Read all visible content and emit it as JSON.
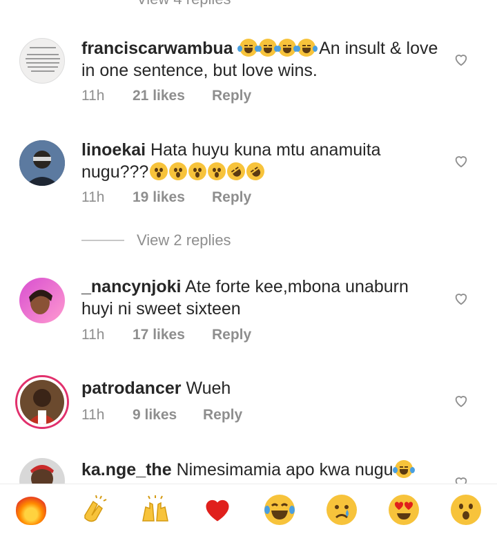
{
  "top_view_replies": "View 4 replies",
  "comments": [
    {
      "username": "franciscarwambua",
      "text": "An insult & love in one sentence, but love wins.",
      "time": "11h",
      "likes": "21 likes",
      "reply": "Reply"
    },
    {
      "username": "linoekai",
      "text": "Hata huyu kuna mtu anamuita nugu???",
      "time": "11h",
      "likes": "19 likes",
      "reply": "Reply"
    },
    {
      "username": "_nancynjoki",
      "text": "Ate forte kee,mbona unaburn huyi ni sweet sixteen",
      "time": "11h",
      "likes": "17 likes",
      "reply": "Reply"
    },
    {
      "username": "patrodancer",
      "text": "Wueh",
      "time": "11h",
      "likes": "9 likes",
      "reply": "Reply"
    },
    {
      "username": "ka.nge_the",
      "text": "Nimesimamia apo kwa nugu"
    }
  ],
  "mid_view_replies": "View 2 replies",
  "reactions": [
    "fire-emoji",
    "clapping-hands-emoji",
    "raising-hands-emoji",
    "red-heart-emoji",
    "tears-of-joy-emoji",
    "crying-face-emoji",
    "heart-eyes-emoji",
    "astonished-face-emoji"
  ],
  "colors": {
    "heart": "#e0201c",
    "meta": "#8e8e8e",
    "story_ring": "#e1306c"
  }
}
